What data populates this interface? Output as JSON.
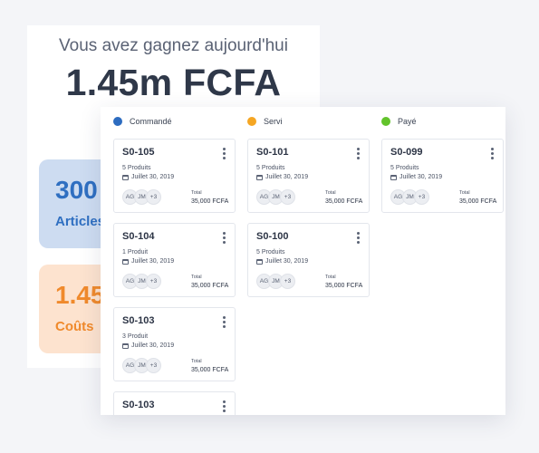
{
  "summary": {
    "earn_label": "Vous avez gagnez aujourd'hui",
    "earn_amount": "1.45m FCFA",
    "stats": [
      {
        "value": "300",
        "label": "Articles",
        "color": "#2f6fc1",
        "bg": "#cddcf1"
      },
      {
        "value": "1.45",
        "label": "Coûts",
        "color": "#f08a2c",
        "bg": "#fde3cf"
      }
    ]
  },
  "board": {
    "columns": [
      {
        "title": "Commandé",
        "color": "#2d6cc0",
        "cards": [
          {
            "id": "S0-105",
            "products": "5 Produits",
            "date": "Juillet 30, 2019",
            "avatars": [
              "AG",
              "JM",
              "+3"
            ],
            "total_label": "Total",
            "total": "35,000 FCFA"
          },
          {
            "id": "S0-104",
            "products": "1 Produit",
            "date": "Juillet 30, 2019",
            "avatars": [
              "AG",
              "JM",
              "+3"
            ],
            "total_label": "Total",
            "total": "35,000 FCFA"
          },
          {
            "id": "S0-103",
            "products": "3 Produit",
            "date": "Juillet 30, 2019",
            "avatars": [
              "AG",
              "JM",
              "+3"
            ],
            "total_label": "Total",
            "total": "35,000 FCFA"
          },
          {
            "id": "S0-103",
            "products": "",
            "date": "",
            "avatars": [],
            "total_label": "",
            "total": ""
          }
        ]
      },
      {
        "title": "Servi",
        "color": "#f5a623",
        "cards": [
          {
            "id": "S0-101",
            "products": "5 Produits",
            "date": "Juillet 30, 2019",
            "avatars": [
              "AG",
              "JM",
              "+3"
            ],
            "total_label": "Total",
            "total": "35,000 FCFA"
          },
          {
            "id": "S0-100",
            "products": "5 Produits",
            "date": "Juillet 30, 2019",
            "avatars": [
              "AG",
              "JM",
              "+3"
            ],
            "total_label": "Total",
            "total": "35,000 FCFA"
          }
        ]
      },
      {
        "title": "Payé",
        "color": "#62c32b",
        "cards": [
          {
            "id": "S0-099",
            "products": "5 Produits",
            "date": "Juillet 30, 2019",
            "avatars": [
              "AG",
              "JM",
              "+3"
            ],
            "total_label": "Total",
            "total": "35,000 FCFA"
          }
        ]
      }
    ]
  }
}
